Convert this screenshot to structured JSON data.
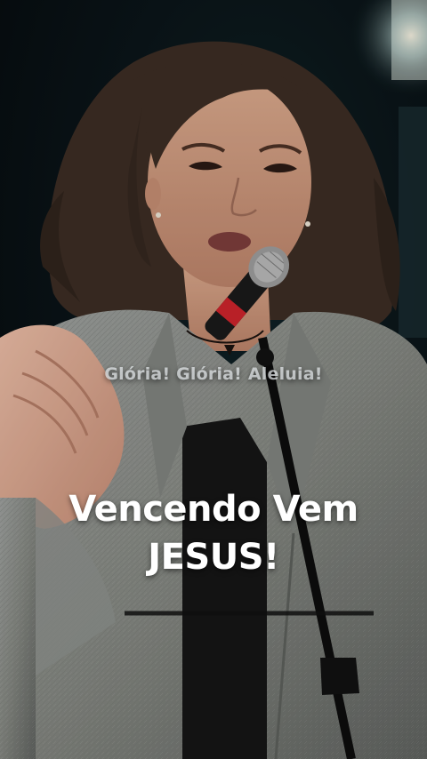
{
  "video": {
    "colors": {
      "background": "#070d10",
      "jacket": "#8d908e",
      "hair": "#3b2c23",
      "skin": "#c9977d",
      "microphone_accent": "#c8232b"
    },
    "captions": {
      "secondary": "Glória! Glória! Aleluia!",
      "primary_line1": "Vencendo Vem",
      "primary_line2": "JESUS!"
    }
  }
}
